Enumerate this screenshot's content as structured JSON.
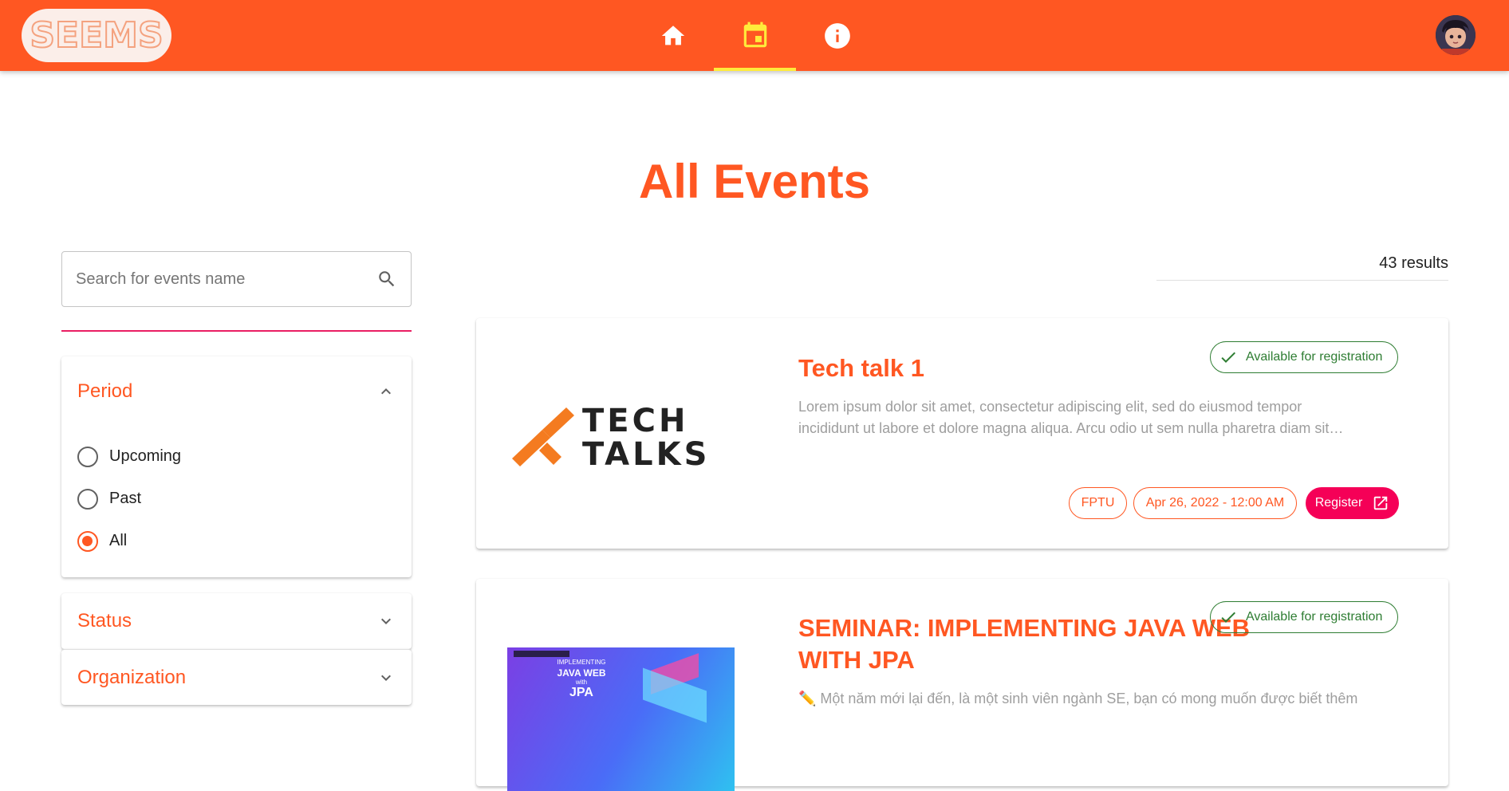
{
  "header": {
    "logo_text": "SEEMS",
    "tabs": [
      {
        "name": "home",
        "icon": "home-icon",
        "active": false
      },
      {
        "name": "events",
        "icon": "calendar-icon",
        "active": true
      },
      {
        "name": "about",
        "icon": "info-icon",
        "active": false
      }
    ],
    "avatar": "user-avatar",
    "colors": {
      "bar": "#ff5722",
      "active_tab_indicator": "#ffeb3b",
      "active_icon": "#ffeb3b",
      "icon": "#ffffff"
    }
  },
  "page": {
    "title": "All Events"
  },
  "sidebar": {
    "search": {
      "placeholder": "Search for events name",
      "value": ""
    },
    "period": {
      "title": "Period",
      "expanded": true,
      "options": [
        "Upcoming",
        "Past",
        "All"
      ],
      "selected": "All"
    },
    "status": {
      "title": "Status",
      "expanded": false
    },
    "organization": {
      "title": "Organization",
      "expanded": false
    }
  },
  "results": {
    "count_text": "43 results",
    "events": [
      {
        "title": "Tech talk 1",
        "image_text": [
          "TECH",
          "TALKS"
        ],
        "description": "Lorem ipsum dolor sit amet, consectetur adipiscing elit, sed do eiusmod tempor incididunt ut labore et dolore magna aliqua. Arcu odio ut sem nulla pharetra diam sit…",
        "status": "Available for registration",
        "organization": "FPTU",
        "date": "Apr 26, 2022 - 12:00 AM",
        "action": "Register"
      },
      {
        "title_line1": "SEMINAR: IMPLEMENTING JAVA WEB",
        "title_line2": "WITH JPA",
        "image_text": [
          "IMPLEMENTING",
          "JAVA WEB",
          "with",
          "JPA"
        ],
        "description": "✏️ Một năm mới lại đến, là một sinh viên ngành SE, bạn có mong muốn được biết thêm",
        "status": "Available for registration"
      }
    ]
  },
  "colors": {
    "accent": "#ff5722",
    "register": "#f50057",
    "available": "#2e7d32",
    "muted_text": "#9e9e9e"
  }
}
